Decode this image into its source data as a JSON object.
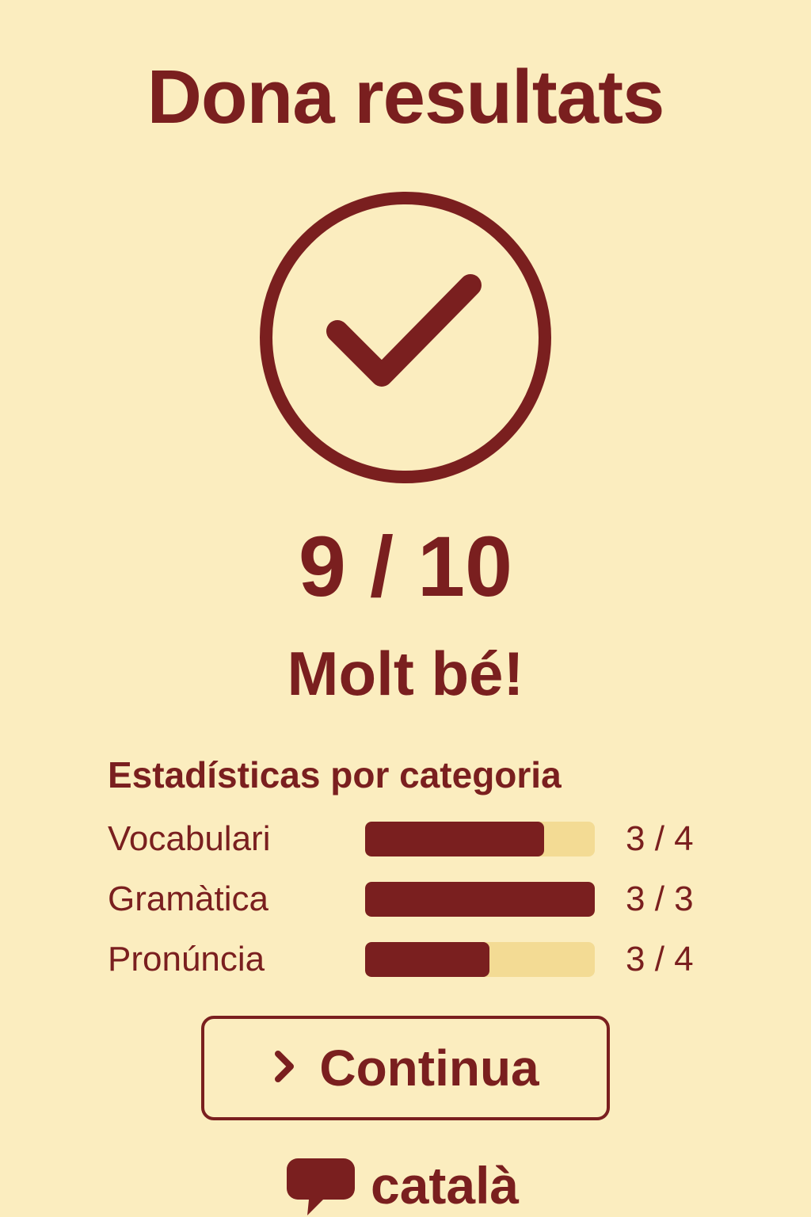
{
  "header": {
    "title": "Dona resultats"
  },
  "result": {
    "icon": "check-circle-icon",
    "score": "9 / 10",
    "verdict": "Molt bé!"
  },
  "stats": {
    "title": "Estadísticas por categoria",
    "items": [
      {
        "label": "Vocabulari",
        "value": "3 / 4",
        "progress": 0.78
      },
      {
        "label": "Gramàtica",
        "value": "3 / 3",
        "progress": 1.0
      },
      {
        "label": "Pronúncia",
        "value": "3 / 4",
        "progress": 0.54
      }
    ]
  },
  "actions": {
    "continue_label": "Continua",
    "continue_icon": "chevron-right-icon"
  },
  "footer": {
    "brand_icon": "speech-bubble-icon",
    "brand_label": "català"
  },
  "colors": {
    "background": "#FBEDBF",
    "accent": "#7A1F1F",
    "track": "#F3DB94"
  }
}
